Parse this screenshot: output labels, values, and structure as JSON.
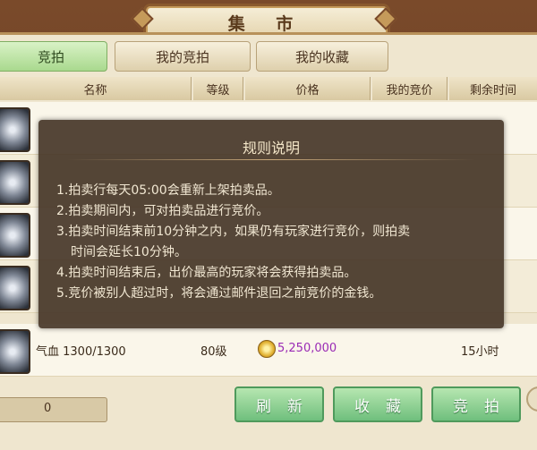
{
  "title": "集 市",
  "tabs": [
    {
      "label": "竞拍",
      "active": true
    },
    {
      "label": "我的竞拍",
      "active": false
    },
    {
      "label": "我的收藏",
      "active": false
    }
  ],
  "columns": [
    "名称",
    "等级",
    "价格",
    "我的竞价",
    "剩余时间"
  ],
  "rows": [
    {
      "name": "",
      "level": "",
      "price": "",
      "time": ""
    },
    {
      "name": "",
      "level": "",
      "price": "",
      "time": ""
    },
    {
      "name": "",
      "level": "",
      "price": "",
      "time": ""
    },
    {
      "name": "",
      "level": "",
      "price": "",
      "time": ""
    },
    {
      "name": "气血 1300/1300",
      "level": "80级",
      "price": "5,250,000",
      "time": "15小时"
    }
  ],
  "money": "0",
  "buttons": {
    "refresh": "刷新",
    "favorite": "收藏",
    "bid": "竞拍"
  },
  "rules_dialog": {
    "title": "规则说明",
    "lines": [
      "1.拍卖行每天05:00会重新上架拍卖品。",
      "2.拍卖期间内，可对拍卖品进行竞价。",
      "3.拍卖时间结束前10分钟之内，如果仍有玩家进行竞价，则拍卖",
      "时间会延长10分钟。",
      "4.拍卖时间结束后，出价最高的玩家将会获得拍卖品。",
      "5.竞价被别人超过时，将会通过邮件退回之前竞价的金钱。"
    ]
  },
  "colors": {
    "price": "#9a2bb5",
    "active_tab": "#a9d98e",
    "button": "#6fbf7d"
  }
}
